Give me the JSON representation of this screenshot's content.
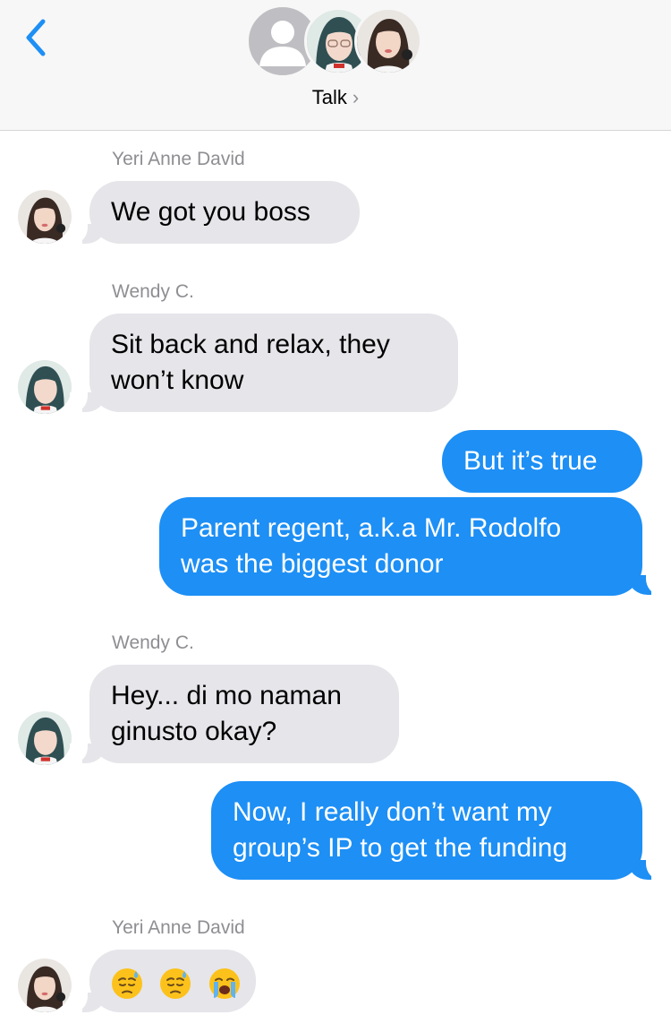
{
  "header": {
    "title": "Talk",
    "title_chevron": "›",
    "back_icon": "chevron-left-icon",
    "accent": "#1d8ff5"
  },
  "messages": [
    {
      "direction": "incoming",
      "sender": "Yeri Anne David",
      "text": "We got you boss"
    },
    {
      "direction": "incoming",
      "sender": "Wendy C.",
      "lines": [
        "Sit back and relax, they",
        "won’t know"
      ]
    },
    {
      "direction": "outgoing",
      "text": "But it’s true"
    },
    {
      "direction": "outgoing",
      "lines": [
        "Parent regent, a.k.a Mr. Rodolfo",
        "was the biggest donor"
      ]
    },
    {
      "direction": "incoming",
      "sender": "Wendy C.",
      "lines": [
        "Hey... di mo naman",
        "ginusto okay?"
      ]
    },
    {
      "direction": "outgoing",
      "lines": [
        "Now, I really don’t want my",
        "group’s IP to get the funding"
      ]
    },
    {
      "direction": "incoming",
      "sender": "Yeri Anne David",
      "emoji": [
        "downcast-sweat-emoji",
        "downcast-sweat-emoji",
        "loudly-crying-emoji"
      ]
    }
  ],
  "colors": {
    "incoming_bubble": "#e5e5ea",
    "outgoing_bubble": "#1d8ff5",
    "sender_name": "#8e8e93"
  }
}
